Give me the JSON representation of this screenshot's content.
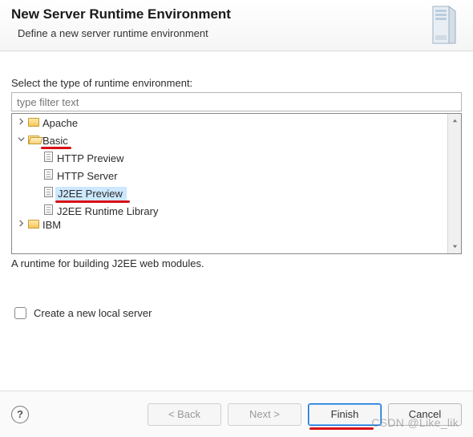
{
  "header": {
    "title": "New Server Runtime Environment",
    "subtitle": "Define a new server runtime environment"
  },
  "prompt": "Select the type of runtime environment:",
  "filter": {
    "placeholder": "type filter text",
    "value": ""
  },
  "tree": {
    "items": [
      {
        "label": "Apache",
        "type": "folder-closed",
        "expanded": false,
        "level": 0,
        "selected": false,
        "underline": false
      },
      {
        "label": "Basic",
        "type": "folder-open",
        "expanded": true,
        "level": 0,
        "selected": false,
        "underline": true
      },
      {
        "label": "HTTP Preview",
        "type": "file",
        "level": 1,
        "selected": false,
        "underline": false
      },
      {
        "label": "HTTP Server",
        "type": "file",
        "level": 1,
        "selected": false,
        "underline": false
      },
      {
        "label": "J2EE Preview",
        "type": "file",
        "level": 1,
        "selected": true,
        "underline": true
      },
      {
        "label": "J2EE Runtime Library",
        "type": "file",
        "level": 1,
        "selected": false,
        "underline": false
      }
    ],
    "partial_next": "IBM"
  },
  "description": "A runtime for building J2EE web modules.",
  "checkbox": {
    "label": "Create a new local server",
    "checked": false
  },
  "buttons": {
    "back": "< Back",
    "next": "Next >",
    "finish": "Finish",
    "cancel": "Cancel"
  },
  "watermark": "CSDN @Like_lik"
}
